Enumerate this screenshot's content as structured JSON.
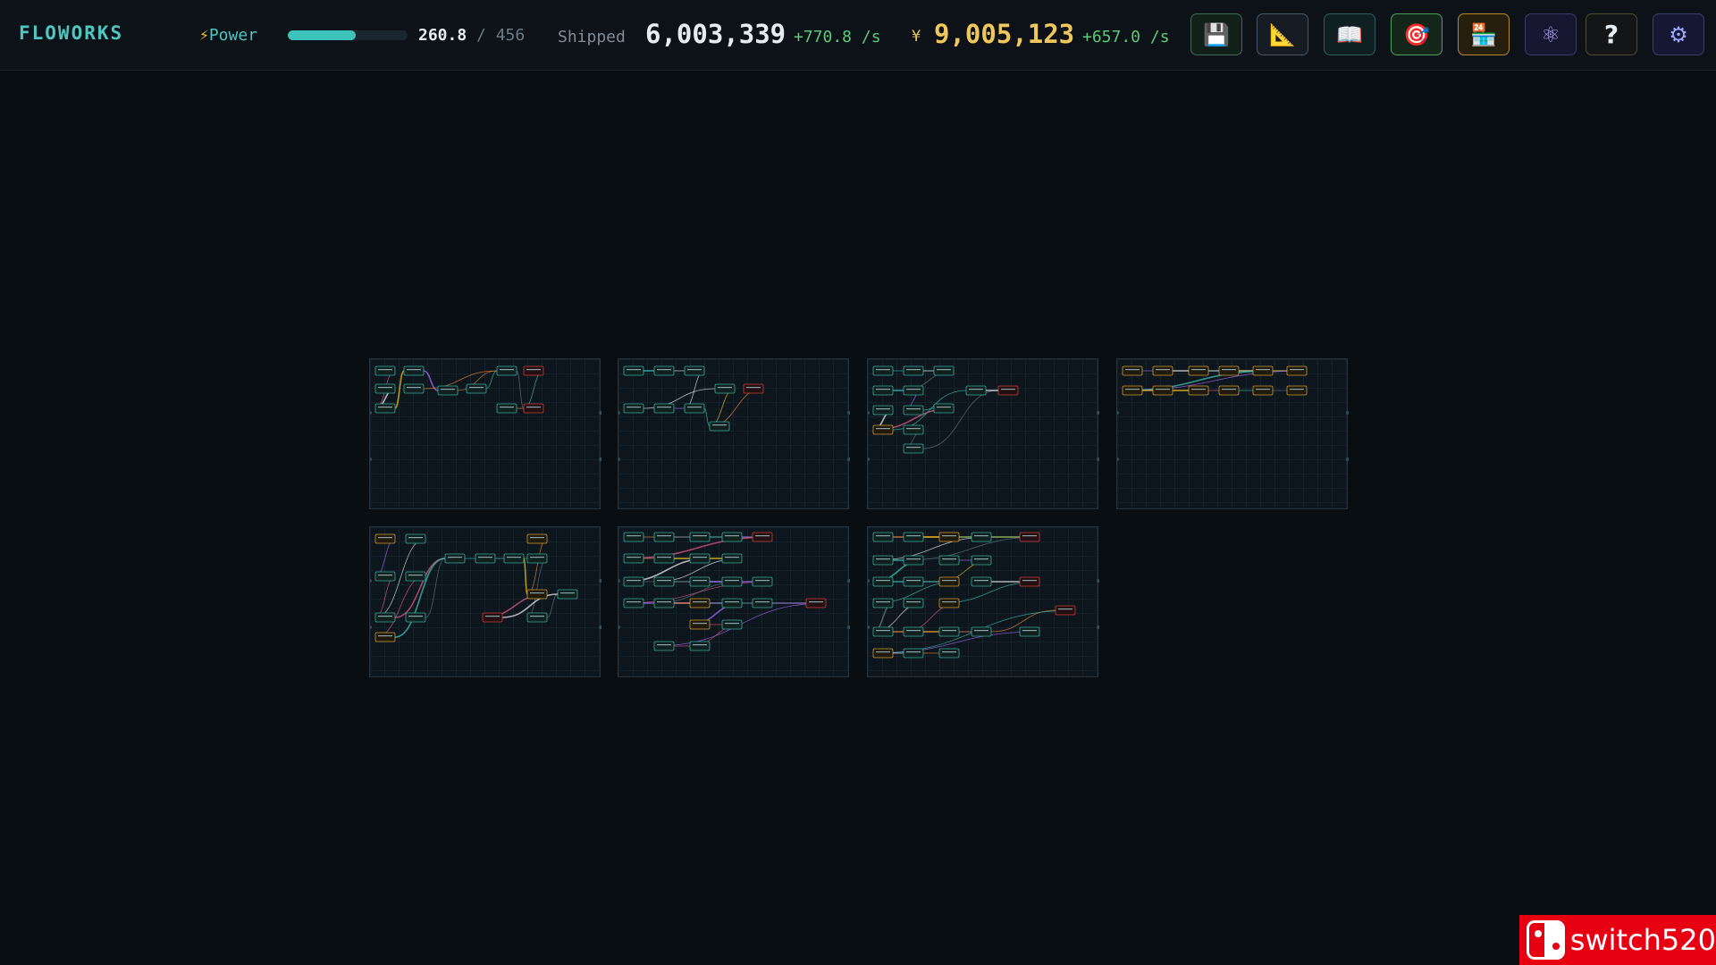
{
  "app": {
    "title": "FLOWORKS"
  },
  "power": {
    "label": "Power",
    "current": "260.8",
    "separator": "/",
    "max": "456",
    "fill_percent": 57
  },
  "shipped": {
    "label": "Shipped",
    "value": "6,003,339",
    "rate": "+770.8 /s"
  },
  "money": {
    "symbol": "¥",
    "value": "9,005,123",
    "rate": "+657.0 /s"
  },
  "toolbar": {
    "buttons": [
      {
        "name": "save-button",
        "icon": "floppy-disk-icon",
        "glyph": "💾"
      },
      {
        "name": "blueprint-button",
        "icon": "triangle-ruler-icon",
        "glyph": "📐"
      },
      {
        "name": "codex-button",
        "icon": "open-book-icon",
        "glyph": "📖"
      },
      {
        "name": "goals-button",
        "icon": "target-icon",
        "glyph": "🎯"
      },
      {
        "name": "shop-button",
        "icon": "store-icon",
        "glyph": "🏪"
      },
      {
        "name": "research-button",
        "icon": "atom-icon",
        "glyph": "⚛"
      },
      {
        "name": "help-button",
        "icon": "question-mark-icon",
        "glyph": "?"
      },
      {
        "name": "settings-button",
        "icon": "gear-icon",
        "glyph": "⚙"
      }
    ]
  },
  "colors": {
    "accent": "#4fc6c0",
    "money": "#f0c75a",
    "rate": "#5cc97a",
    "node_teal": "#3aa79a",
    "node_gold": "#c79a3a",
    "node_red": "#c2403e"
  },
  "boards": [
    {
      "id": 1,
      "theme": "mixed",
      "node_count": 13
    },
    {
      "id": 2,
      "theme": "mixed",
      "node_count": 11
    },
    {
      "id": 3,
      "theme": "mixed",
      "node_count": 14
    },
    {
      "id": 4,
      "theme": "storage",
      "node_count": 12
    },
    {
      "id": 5,
      "theme": "mixed",
      "node_count": 16
    },
    {
      "id": 6,
      "theme": "dense",
      "node_count": 22
    },
    {
      "id": 7,
      "theme": "dense",
      "node_count": 26
    }
  ],
  "watermark": {
    "text": "switch520",
    "icon": "switch-logo-icon"
  }
}
